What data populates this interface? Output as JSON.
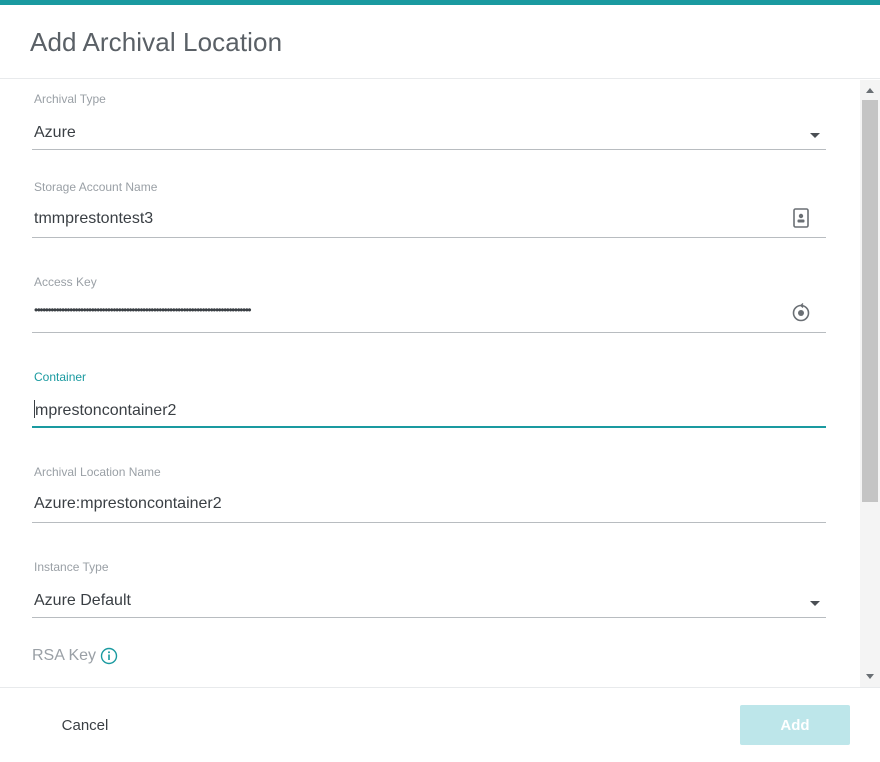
{
  "dialog": {
    "title": "Add Archival Location"
  },
  "form": {
    "archival_type": {
      "label": "Archival Type",
      "value": "Azure"
    },
    "storage_account_name": {
      "label": "Storage Account Name",
      "value": "tmmprestontest3"
    },
    "access_key": {
      "label": "Access Key",
      "value": "••••••••••••••••••••••••••••••••••••••••••••••••••••••••••••••••••••••••••••••••"
    },
    "container": {
      "label": "Container",
      "value": "mprestoncontainer2"
    },
    "archival_location_name": {
      "label": "Archival Location Name",
      "value": "Azure:mprestoncontainer2"
    },
    "instance_type": {
      "label": "Instance Type",
      "value": "Azure Default"
    },
    "rsa_key": {
      "label": "RSA Key"
    }
  },
  "footer": {
    "cancel_label": "Cancel",
    "add_label": "Add"
  },
  "colors": {
    "accent": "#1a9aa0",
    "add_button_disabled": "#bde6ea"
  },
  "icons": {
    "archival_type_dropdown": "chevron-down-icon",
    "storage_account": "contact-card-icon",
    "access_key": "reveal-key-icon",
    "instance_type_dropdown": "chevron-down-icon",
    "rsa_info": "info-icon"
  }
}
